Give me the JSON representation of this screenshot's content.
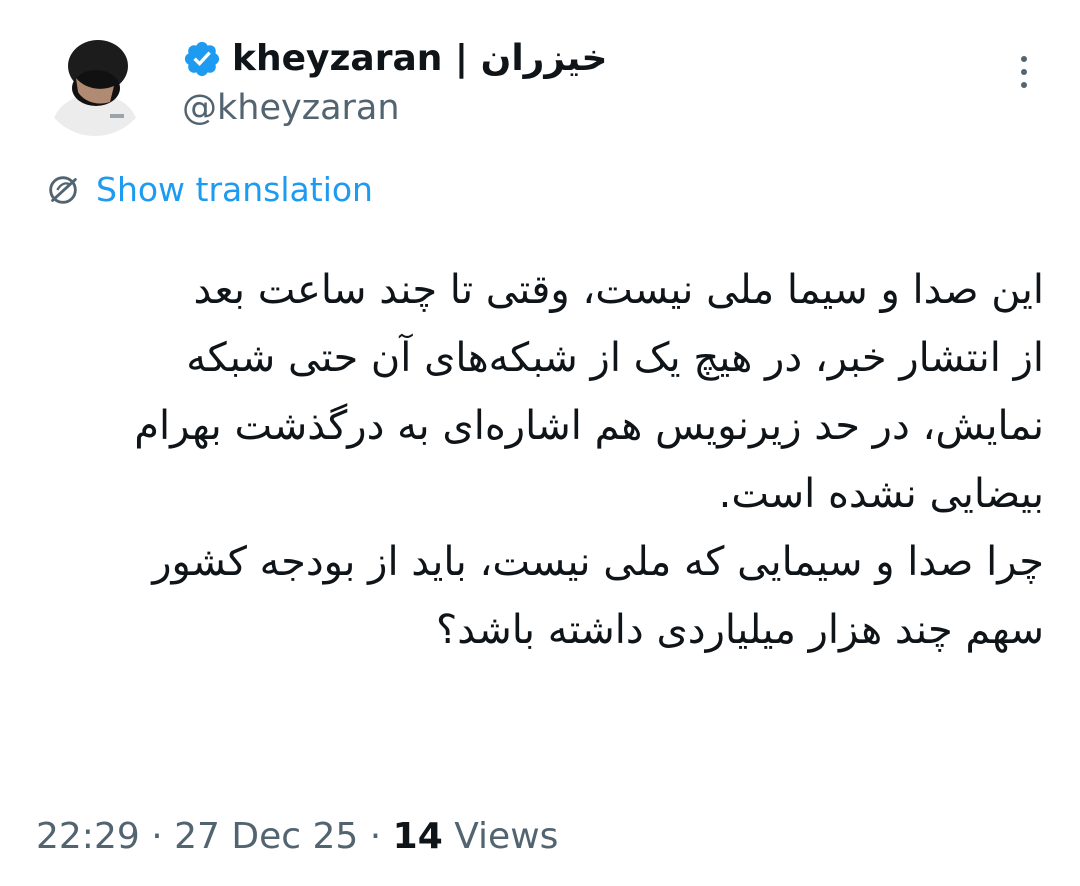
{
  "author": {
    "display_name": "kheyzaran | خیزران",
    "handle": "@kheyzaran",
    "verified": true,
    "verified_color": "#1d9bf0"
  },
  "translate": {
    "label": "Show translation"
  },
  "tweet": {
    "direction": "rtl",
    "lines": [
      "این صدا و سیما ملی نیست، وقتی تا چند ساعت بعد",
      "از انتشار خبر، در هیچ یک از شبکه‌های آن حتی شبکه",
      "نمایش، در حد زیرنویس هم اشاره‌ای به درگذشت بهرام",
      "بیضایی نشده است.",
      "چرا صدا و سیمایی که ملی نیست، باید از بودجه کشور",
      "سهم چند هزار میلیاردی داشته باشد؟"
    ]
  },
  "meta": {
    "time": "22:29",
    "separator": "·",
    "date": "27 Dec 25",
    "views_count": "14",
    "views_label": "Views"
  },
  "colors": {
    "link": "#1d9bf0",
    "secondary_text": "#536471",
    "primary_text": "#0f1419"
  },
  "icons": {
    "verified": "verified-badge-icon",
    "more": "more-options-icon",
    "translate": "globe-icon"
  }
}
